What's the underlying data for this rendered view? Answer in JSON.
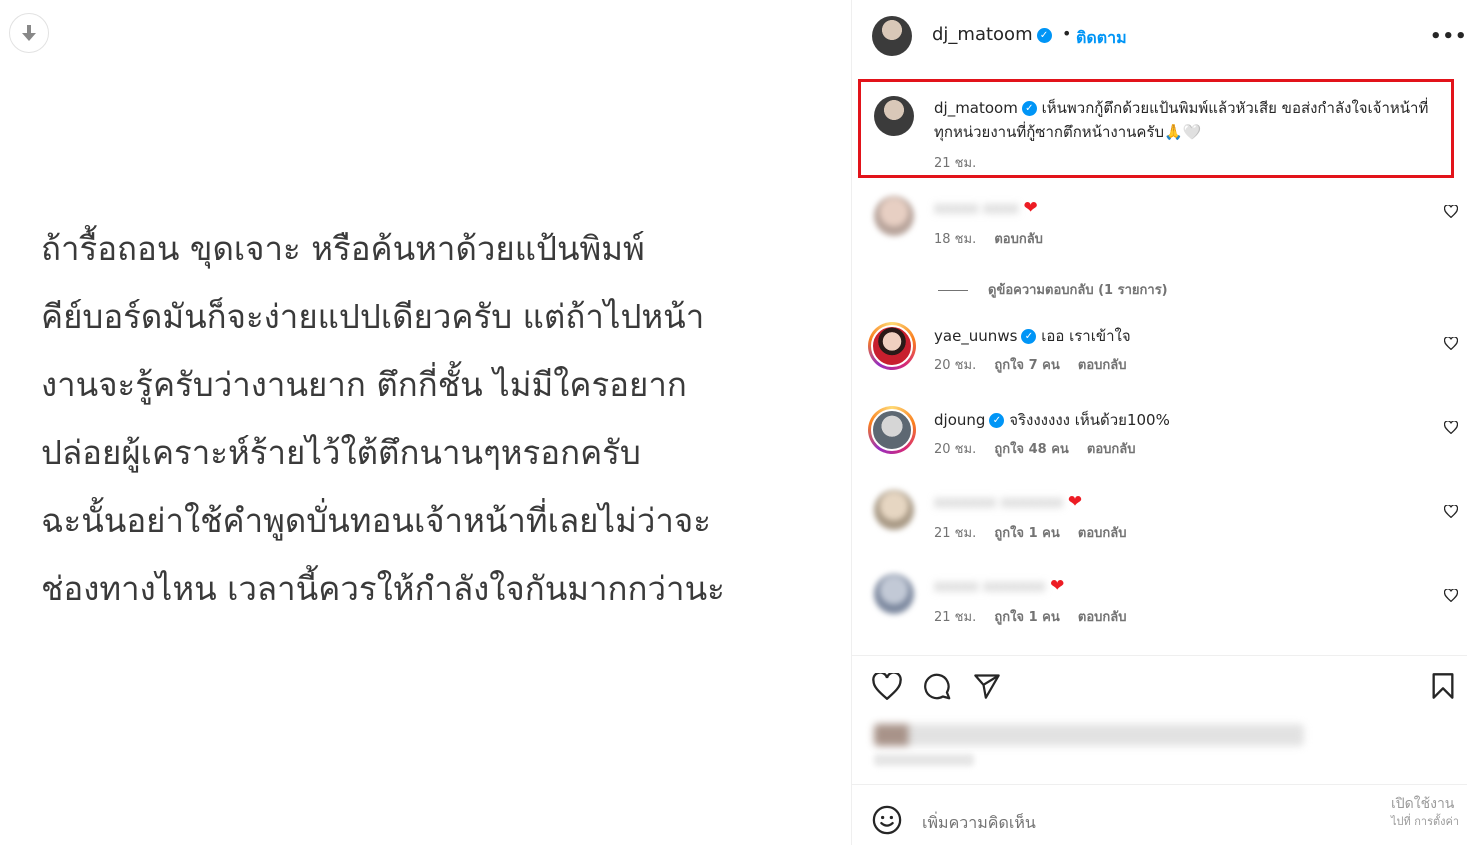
{
  "post_image": {
    "text": "ถ้ารื้อถอน ขุดเจาะ หรือค้นหาด้วยแป้นพิมพ์\nคีย์บอร์ดมันก็จะง่ายแปปเดียวครับ แต่ถ้าไปหน้า\nงานจะรู้ครับว่างานยาก ตึกกี่ชั้น ไม่มีใครอยาก\nปล่อยผู้เคราะห์ร้ายไว้ใต้ตึกนานๆหรอกครับ\nฉะนั้นอย่าใช้คำพูดบั่นทอนเจ้าหน้าที่เลยไม่ว่าจะ\nช่องทางไหน เวลานี้ควรให้กำลังใจกันมากกว่านะ",
    "download_icon": "arrow-down-icon"
  },
  "header": {
    "username": "dj_matoom",
    "dot": "•",
    "follow_label": "ติดตาม",
    "more_label": "•••"
  },
  "caption": {
    "username": "dj_matoom",
    "text": "เห็นพวกกู้ตึกด้วยแป้นพิมพ์แล้วหัวเสีย ขอส่งกำลังใจเจ้าหน้าที่ทุกหน่วยงานที่กู้ซากตึกหน้างานครับ🙏🤍",
    "time": "21 ชม."
  },
  "view_replies": "ดูข้อความตอบกลับ (1 รายการ)",
  "comments": [
    {
      "username": "xxxxx xxxx",
      "text": "❤",
      "time": "18 ชม.",
      "likes": "",
      "reply": "ตอบกลับ",
      "blurred": true
    },
    {
      "username": "yae_uunws",
      "text": "เออ เราเข้าใจ",
      "time": "20 ชม.",
      "likes": "ถูกใจ 7 คน",
      "reply": "ตอบกลับ",
      "blurred": false
    },
    {
      "username": "djoung",
      "text": "จริงงงงงง เห็นด้วย100%",
      "time": "20 ชม.",
      "likes": "ถูกใจ 48 คน",
      "reply": "ตอบกลับ",
      "blurred": false
    },
    {
      "username": "xxxxxxx xxxxxxx",
      "text": "❤",
      "time": "21 ชม.",
      "likes": "ถูกใจ 1 คน",
      "reply": "ตอบกลับ",
      "blurred": true
    },
    {
      "username": "xxxxx xxxxxxx",
      "text": "❤",
      "time": "21 ชม.",
      "likes": "ถูกใจ 1 คน",
      "reply": "ตอบกลับ",
      "blurred": true
    }
  ],
  "add_comment": {
    "placeholder": "เพิ่มความคิดเห็น",
    "watermark_line1": "เปิดใช้งาน",
    "watermark_line2": "ไปที่ การตั้งค่า"
  },
  "colors": {
    "accent": "#0095f6",
    "highlight_border": "#e2131a",
    "heart_red": "#ed1c24"
  }
}
